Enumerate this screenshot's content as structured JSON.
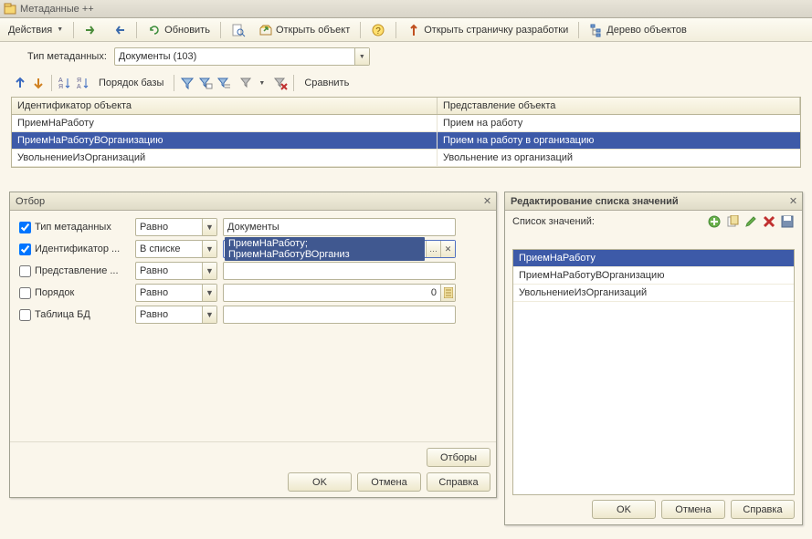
{
  "window_title": "Метаданные ++",
  "toolbar": {
    "actions": "Действия",
    "refresh": "Обновить",
    "open_obj": "Открыть объект",
    "open_dev": "Открыть страничку разработки",
    "tree": "Дерево объектов"
  },
  "filter_bar": {
    "label": "Тип метаданных:",
    "value": "Документы (103)"
  },
  "strip2": {
    "order": "Порядок базы",
    "compare": "Сравнить"
  },
  "grid": {
    "col1": "Идентификатор объекта",
    "col2": "Представление объекта",
    "rows": [
      {
        "id": "ПриемНаРаботу",
        "repr": "Прием на работу",
        "selected": false
      },
      {
        "id": "ПриемНаРаботуВОрганизацию",
        "repr": "Прием на работу в организацию",
        "selected": true
      },
      {
        "id": "УвольнениеИзОрганизаций",
        "repr": "Увольнение из организаций",
        "selected": false
      }
    ]
  },
  "filter_panel": {
    "title": "Отбор",
    "rows": [
      {
        "label": "Тип метаданных",
        "checked": true,
        "cond": "Равно",
        "val": "Документы",
        "kind": "text"
      },
      {
        "label": "Идентификатор ...",
        "checked": true,
        "cond": "В списке",
        "val": "ПриемНаРаботу; ПриемНаРаботуВОрганиз",
        "kind": "selection"
      },
      {
        "label": "Представление ...",
        "checked": false,
        "cond": "Равно",
        "val": "",
        "kind": "text"
      },
      {
        "label": "Порядок",
        "checked": false,
        "cond": "Равно",
        "val": "0",
        "kind": "number"
      },
      {
        "label": "Таблица БД",
        "checked": false,
        "cond": "Равно",
        "val": "",
        "kind": "text"
      }
    ],
    "filters_btn": "Отборы",
    "ok": "OK",
    "cancel": "Отмена",
    "help": "Справка"
  },
  "values_panel": {
    "title": "Редактирование списка значений",
    "list_label": "Список значений:",
    "items": [
      {
        "text": "ПриемНаРаботу",
        "selected": true
      },
      {
        "text": "ПриемНаРаботуВОрганизацию",
        "selected": false
      },
      {
        "text": "УвольнениеИзОрганизаций",
        "selected": false
      }
    ],
    "ok": "OK",
    "cancel": "Отмена",
    "help": "Справка"
  }
}
